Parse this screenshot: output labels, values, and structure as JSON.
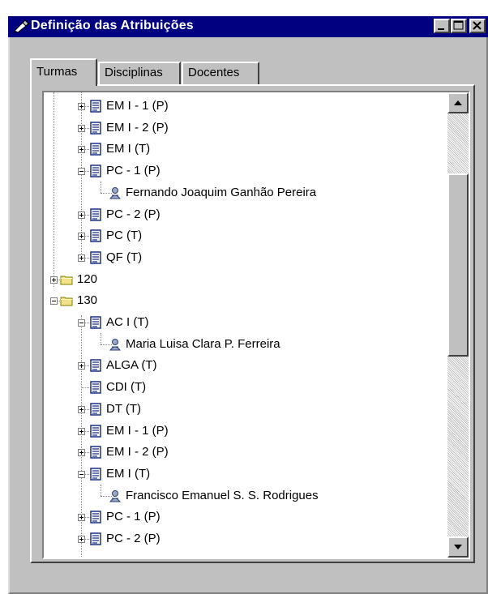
{
  "window": {
    "title": "Definição das Atribuições",
    "colors": {
      "titlebar": "#000080",
      "face": "#c0c0c0",
      "tree_bg": "#ffffff"
    }
  },
  "titlebar_buttons": [
    {
      "name": "minimize",
      "icon": "minimize-icon"
    },
    {
      "name": "maximize",
      "icon": "maximize-icon"
    },
    {
      "name": "close",
      "icon": "close-icon"
    }
  ],
  "tabs": [
    {
      "label": "Turmas",
      "active": true
    },
    {
      "label": "Disciplinas",
      "active": false
    },
    {
      "label": "Docentes",
      "active": false
    }
  ],
  "tree": {
    "items": [
      {
        "label": "EM I - 1 (P)",
        "level": 2,
        "type": "class",
        "expander": "plus"
      },
      {
        "label": "EM I - 2 (P)",
        "level": 2,
        "type": "class",
        "expander": "plus"
      },
      {
        "label": "EM I (T)",
        "level": 2,
        "type": "class",
        "expander": "plus"
      },
      {
        "label": "PC - 1 (P)",
        "level": 2,
        "type": "class",
        "expander": "minus"
      },
      {
        "label": "Fernando Joaquim Ganhão Pereira",
        "level": 3,
        "type": "person",
        "expander": "none"
      },
      {
        "label": "PC - 2 (P)",
        "level": 2,
        "type": "class",
        "expander": "plus"
      },
      {
        "label": "PC (T)",
        "level": 2,
        "type": "class",
        "expander": "plus"
      },
      {
        "label": "QF (T)",
        "level": 2,
        "type": "class",
        "expander": "plus"
      },
      {
        "label": "120",
        "level": 1,
        "type": "folder",
        "expander": "plus"
      },
      {
        "label": "130",
        "level": 1,
        "type": "folder",
        "expander": "minus"
      },
      {
        "label": "AC I (T)",
        "level": 2,
        "type": "class",
        "expander": "minus"
      },
      {
        "label": "Maria Luisa Clara P. Ferreira",
        "level": 3,
        "type": "person",
        "expander": "none"
      },
      {
        "label": "ALGA (T)",
        "level": 2,
        "type": "class",
        "expander": "plus"
      },
      {
        "label": "CDI (T)",
        "level": 2,
        "type": "class",
        "expander": "none"
      },
      {
        "label": "DT (T)",
        "level": 2,
        "type": "class",
        "expander": "plus"
      },
      {
        "label": "EM I - 1 (P)",
        "level": 2,
        "type": "class",
        "expander": "plus"
      },
      {
        "label": "EM I - 2 (P)",
        "level": 2,
        "type": "class",
        "expander": "plus"
      },
      {
        "label": "EM I (T)",
        "level": 2,
        "type": "class",
        "expander": "minus"
      },
      {
        "label": "Francisco Emanuel S. S. Rodrigues",
        "level": 3,
        "type": "person",
        "expander": "none"
      },
      {
        "label": "PC - 1 (P)",
        "level": 2,
        "type": "class",
        "expander": "plus"
      },
      {
        "label": "PC - 2 (P)",
        "level": 2,
        "type": "class",
        "expander": "plus"
      }
    ]
  },
  "scrollbar": {
    "position_fraction": 0.25,
    "icons": [
      "scroll-up-arrow-icon",
      "scroll-down-arrow-icon"
    ]
  }
}
